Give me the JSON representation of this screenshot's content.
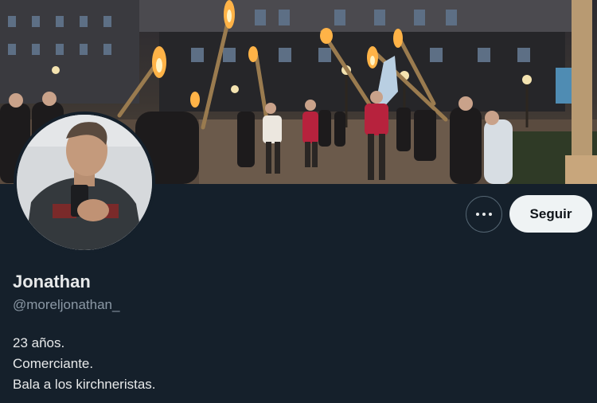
{
  "profile": {
    "display_name": "Jonathan",
    "handle": "@moreljonathan_",
    "bio_lines": [
      "23 años.",
      "Comerciante.",
      "Bala a los kirchneristas."
    ]
  },
  "actions": {
    "more_icon": "more-horizontal-icon",
    "follow_label": "Seguir"
  },
  "colors": {
    "background": "#15202b",
    "primary_text": "#e7e9ea",
    "secondary_text": "#8b98a5",
    "follow_button_bg": "#eff3f4"
  }
}
